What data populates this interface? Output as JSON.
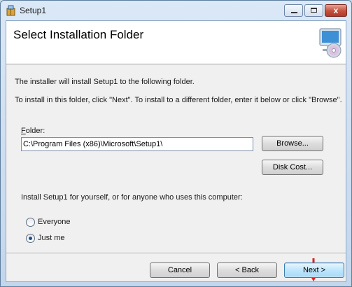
{
  "window": {
    "title": "Setup1",
    "icon": "setup-package-icon"
  },
  "caption_buttons": {
    "minimize_icon": "minimize-icon",
    "maximize_icon": "maximize-icon",
    "close_glyph": "x"
  },
  "banner": {
    "title": "Select Installation Folder",
    "icon": "computer-cd-icon"
  },
  "body": {
    "intro": "The installer will install Setup1 to the following folder.",
    "instructions": "To install in this folder, click \"Next\". To install to a different folder, enter it below or click \"Browse\"."
  },
  "folder": {
    "label_accel": "F",
    "label_rest": "older:",
    "value": "C:\\Program Files (x86)\\Microsoft\\Setup1\\",
    "browse_label": "Browse...",
    "disk_cost_label": "Disk Cost..."
  },
  "install_scope": {
    "question": "Install Setup1 for yourself, or for anyone who uses this computer:",
    "options": [
      {
        "label": "Everyone",
        "selected": false
      },
      {
        "label": "Just me",
        "selected": true
      }
    ]
  },
  "footer": {
    "cancel_label": "Cancel",
    "back_label": "< Back",
    "next_label": "Next >"
  },
  "colors": {
    "pointer_arrow": "#e02020",
    "accent": "#3c7fb1"
  }
}
